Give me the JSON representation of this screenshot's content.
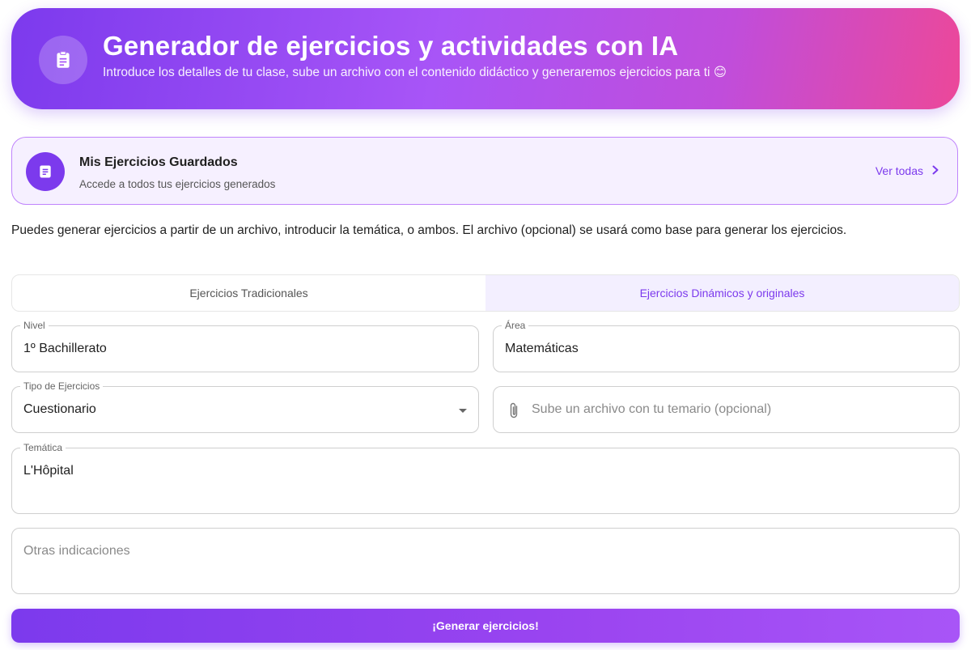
{
  "header": {
    "title": "Generador de ejercicios y actividades con IA",
    "subtitle": "Introduce los detalles de tu clase, sube un archivo con el contenido didáctico y generaremos ejercicios para ti 😊",
    "icon": "clipboard-icon"
  },
  "saved": {
    "title": "Mis Ejercicios Guardados",
    "subtitle": "Accede a todos tus ejercicios generados",
    "link_label": "Ver todas",
    "icon": "document-icon"
  },
  "intro": "Puedes generar ejercicios a partir de un archivo, introducir la temática, o ambos. El archivo (opcional) se usará como base para generar los ejercicios.",
  "tabs": [
    {
      "label": "Ejercicios Tradicionales",
      "active": false
    },
    {
      "label": "Ejercicios Dinámicos y originales",
      "active": true
    }
  ],
  "form": {
    "nivel": {
      "label": "Nivel",
      "value": "1º Bachillerato"
    },
    "area": {
      "label": "Área",
      "value": "Matemáticas"
    },
    "tipo": {
      "label": "Tipo de Ejercicios",
      "value": "Cuestionario"
    },
    "upload": {
      "placeholder": "Sube un archivo con tu temario (opcional)",
      "icon": "paperclip-icon"
    },
    "tematica": {
      "label": "Temática",
      "value": "L'Hôpital"
    },
    "otras": {
      "placeholder": "Otras indicaciones"
    }
  },
  "generate_label": "¡Generar ejercicios!",
  "colors": {
    "accent": "#7c3aed",
    "gradient_end": "#ec4899",
    "saved_bg": "#f6f0ff"
  }
}
